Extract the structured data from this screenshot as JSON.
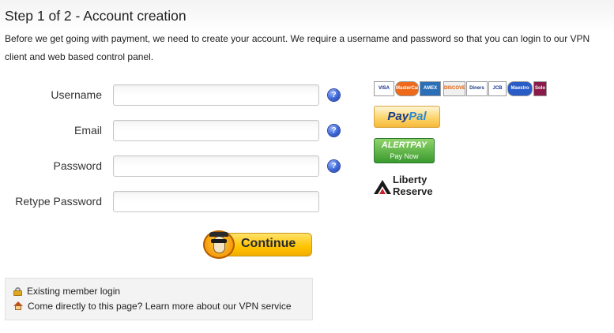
{
  "page": {
    "title": "Step 1 of 2 - Account creation",
    "intro": "Before we get going with payment, we need to create your account. We require a username and password so that you can login to our VPN client and web based control panel."
  },
  "form": {
    "fields": [
      {
        "label": "Username",
        "value": "",
        "help": true
      },
      {
        "label": "Email",
        "value": "",
        "help": true
      },
      {
        "label": "Password",
        "value": "",
        "help": true
      },
      {
        "label": "Retype Password",
        "value": "",
        "help": false
      }
    ],
    "help_glyph": "?",
    "submit_label": "Continue"
  },
  "info": {
    "login_link": "Existing member login",
    "learn_more": "Come directly to this page? Learn more about our VPN service"
  },
  "payments": {
    "cards": [
      {
        "label": "VISA",
        "bg": "#ffffff",
        "fg": "#1a2a8a"
      },
      {
        "label": "MasterCard",
        "bg": "#ee6a1a",
        "fg": "#ffffff"
      },
      {
        "label": "AMEX",
        "bg": "#2a6fb8",
        "fg": "#ffffff"
      },
      {
        "label": "DISCOVER",
        "bg": "#f0f0f0",
        "fg": "#e05a00"
      },
      {
        "label": "Diners",
        "bg": "#ffffff",
        "fg": "#1a3a7a"
      },
      {
        "label": "JCB",
        "bg": "#ffffff",
        "fg": "#1a3a9a"
      },
      {
        "label": "Maestro",
        "bg": "#2a5cc8",
        "fg": "#ffffff"
      },
      {
        "label": "Solo",
        "bg": "#8a1a4a",
        "fg": "#ffffff"
      }
    ],
    "paypal_a": "Pay",
    "paypal_b": "Pal",
    "alertpay_brand": "ALERTPAY",
    "alertpay_action": "Pay Now",
    "liberty_line1": "Liberty",
    "liberty_line2": "Reserve"
  },
  "colors": {
    "button_yellow": "#ffc300",
    "help_blue": "#3c66d6",
    "info_bg": "#f3f3f3"
  }
}
